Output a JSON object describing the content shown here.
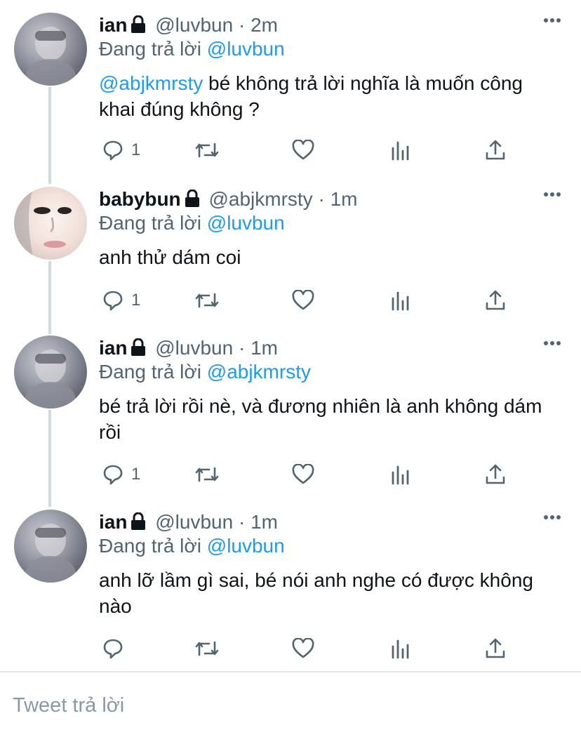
{
  "tweets": [
    {
      "name": "ian",
      "handle": "@luvbun",
      "time": "2m",
      "replying_prefix": "Đang trả lời",
      "replying_to": "@luvbun",
      "mention": "@abjkmrsty",
      "text": " bé không trả lời nghĩa là muốn công khai đúng không ?",
      "reply_count": "1"
    },
    {
      "name": "babybun",
      "handle": "@abjkmrsty",
      "time": "1m",
      "replying_prefix": "Đang trả lời",
      "replying_to": "@luvbun",
      "text": "anh thử dám coi",
      "reply_count": "1"
    },
    {
      "name": "ian",
      "handle": "@luvbun",
      "time": "1m",
      "replying_prefix": "Đang trả lời",
      "replying_to": "@abjkmrsty",
      "text": "bé trả lời rồi nè, và đương nhiên là anh không dám rồi",
      "reply_count": "1"
    },
    {
      "name": "ian",
      "handle": "@luvbun",
      "time": "1m",
      "replying_prefix": "Đang trả lời",
      "replying_to": "@luvbun",
      "text": "anh lỡ lầm gì sai, bé nói anh nghe có được không nào",
      "reply_count": ""
    }
  ],
  "separator": "·",
  "reply_input": {
    "placeholder": "Tweet trả lời"
  },
  "colors": {
    "link": "#1d9bf0",
    "muted": "#536471",
    "thread_line": "#cfd9de"
  }
}
